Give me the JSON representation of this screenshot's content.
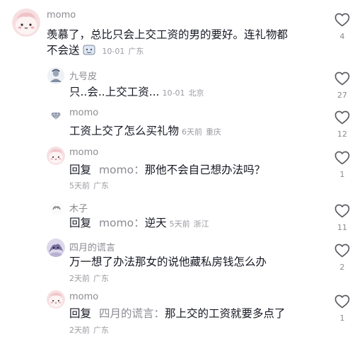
{
  "comments": [
    {
      "name": "momo",
      "text_a": "羡慕了，总比只会上交工资的男的要好。连礼物都",
      "text_b": "不会送",
      "date": "10-01",
      "location": "广东",
      "likes": "4"
    },
    {
      "name": "九号皮",
      "text": "只..会..上交工资...",
      "date": "10-01",
      "location": "北京",
      "likes": "27"
    },
    {
      "name": "momo",
      "text": "工资上交了怎么买礼物",
      "date": "6天前",
      "location": "重庆",
      "likes": "12"
    },
    {
      "name": "momo",
      "reply_prefix": "回复",
      "reply_to": "momo：",
      "text": "那他不会自己想办法吗？",
      "date": "5天前",
      "location": "广东",
      "likes": "1"
    },
    {
      "name": "木子",
      "reply_prefix": "回复",
      "reply_to": "momo：",
      "text": "逆天",
      "date": "5天前",
      "location": "浙江",
      "likes": "11"
    },
    {
      "name": "四月的谎言",
      "text": "万一想了办法那女的说他藏私房钱怎么办",
      "date": "2天前",
      "location": "广东",
      "likes": "2"
    },
    {
      "name": "momo",
      "reply_prefix": "回复",
      "reply_to": "四月的谎言：",
      "text": "那上交的工资就要多点了",
      "date": "2天前",
      "location": "广东",
      "likes": "1"
    }
  ],
  "icons": {
    "like": "heart-outline-icon",
    "emoji": "emoji-sticker-icon"
  },
  "colors": {
    "text": "#161823",
    "secondary": "#8a8b91",
    "meta": "#9a9ba1",
    "avatar_pink": "#f6d6d8"
  }
}
